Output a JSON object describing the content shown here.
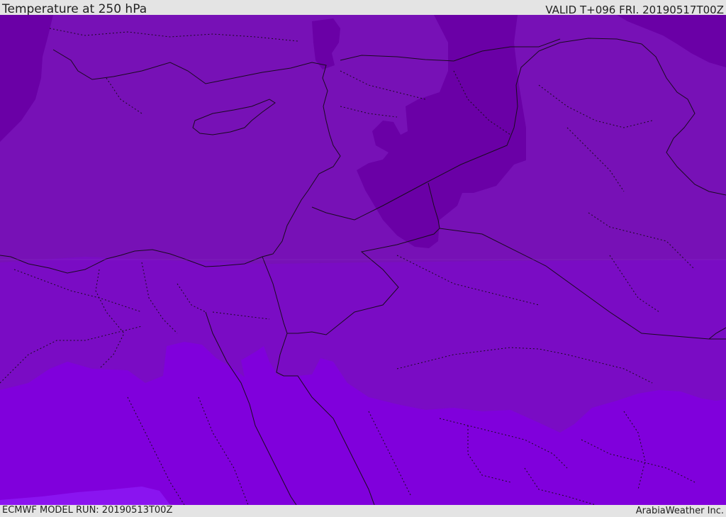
{
  "header": {
    "title": "Temperature at 250 hPa",
    "valid": "VALID T+096 FRI. 20190517T00Z"
  },
  "footer": {
    "model_run": "ECMWF MODEL RUN: 20190513T00Z",
    "credit": "ArabiaWeather Inc."
  },
  "map": {
    "variable": "Temperature",
    "level": "250 hPa",
    "colors": {
      "band_coldest": "#6a00a8",
      "band_cold": "#7710b8",
      "band_mid": "#7b0ac8",
      "band_warm": "#8000e0",
      "band_warmest": "#8a16f0",
      "coast": "#1a0a20"
    }
  }
}
